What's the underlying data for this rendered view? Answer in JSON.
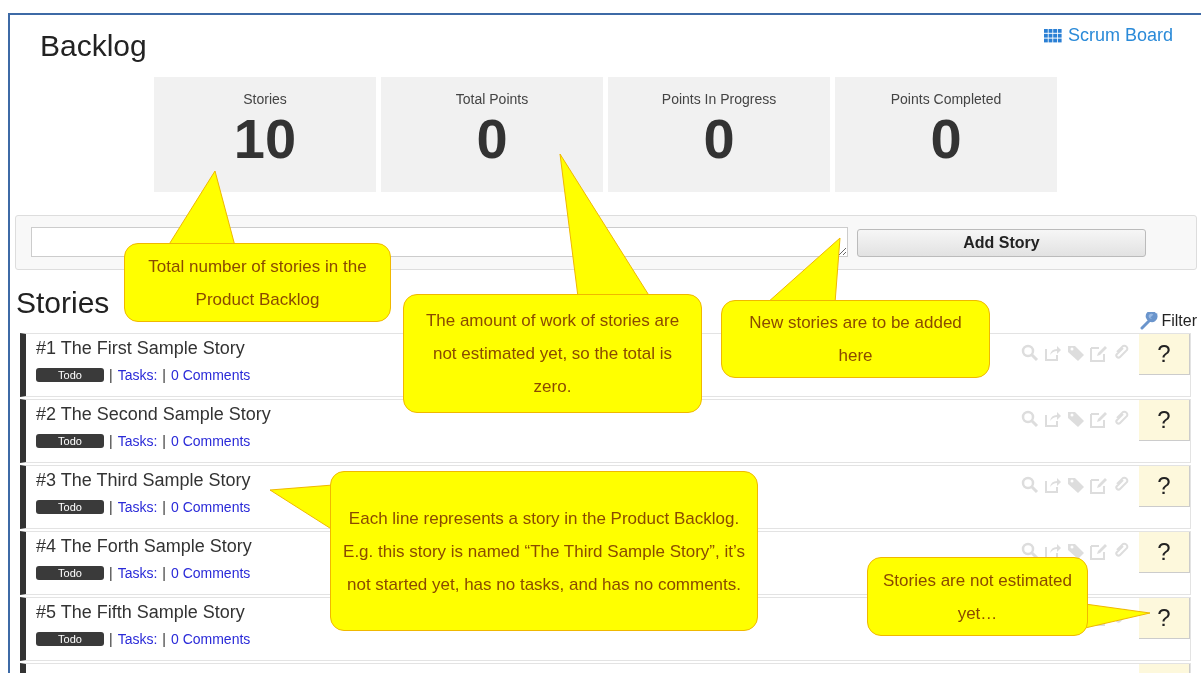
{
  "page": {
    "title": "Backlog",
    "scrum_board_link": "Scrum Board"
  },
  "stats": [
    {
      "label": "Stories",
      "value": "10"
    },
    {
      "label": "Total Points",
      "value": "0"
    },
    {
      "label": "Points In Progress",
      "value": "0"
    },
    {
      "label": "Points Completed",
      "value": "0"
    }
  ],
  "add_story": {
    "button": "Add Story"
  },
  "stories_heading": "Stories",
  "filter": "Filter",
  "stories": [
    {
      "title": "#1 The First Sample Story",
      "status": "Todo",
      "separator_1": "|",
      "separator_2": "|",
      "tasks": "Tasks:",
      "comments": "0 Comments",
      "estimate": "?"
    },
    {
      "title": "#2 The Second Sample Story",
      "status": "Todo",
      "separator_1": "|",
      "separator_2": "|",
      "tasks": "Tasks:",
      "comments": "0 Comments",
      "estimate": "?"
    },
    {
      "title": "#3 The Third Sample Story",
      "status": "Todo",
      "separator_1": "|",
      "separator_2": "|",
      "tasks": "Tasks:",
      "comments": "0 Comments",
      "estimate": "?"
    },
    {
      "title": "#4 The Forth Sample Story",
      "status": "Todo",
      "separator_1": "|",
      "separator_2": "|",
      "tasks": "Tasks:",
      "comments": "0 Comments",
      "estimate": "?"
    },
    {
      "title": "#5 The Fifth Sample Story",
      "status": "Todo",
      "separator_1": "|",
      "separator_2": "|",
      "tasks": "Tasks:",
      "comments": "0 Comments",
      "estimate": "?"
    }
  ],
  "callouts": [
    {
      "text": "Total number of stories in the Product Backlog"
    },
    {
      "text": "The amount of work of stories are not estimated yet, so the total is zero."
    },
    {
      "text": "New stories are to be added here"
    },
    {
      "text": "Each line represents a story in the Product Backlog. E.g. this story is named “The Third Sample Story”, it’s not started yet, has no tasks, and has no comments."
    },
    {
      "text": "Stories are not estimated yet…"
    }
  ]
}
